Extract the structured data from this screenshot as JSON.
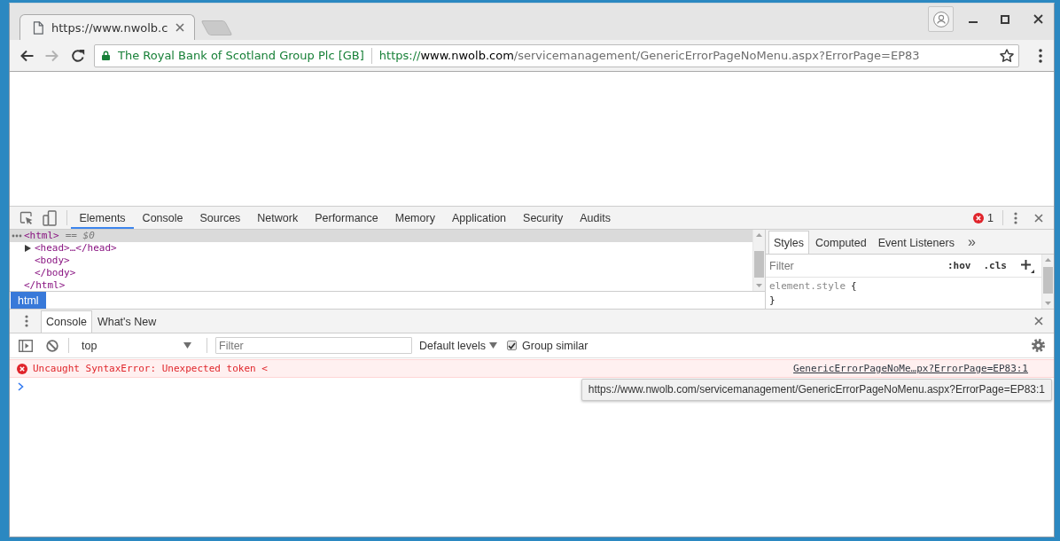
{
  "browser": {
    "tabs": [
      {
        "title": "https://www.nwolb.c",
        "selected": true
      }
    ],
    "nav_buttons": [
      {
        "kind": "back",
        "disabled": false
      },
      {
        "kind": "forward",
        "disabled": true
      },
      {
        "kind": "reload",
        "disabled": false
      }
    ],
    "address_bar": {
      "ev_name": "The Royal Bank of Scotland Group Plc [GB]",
      "url": [
        {
          "kind": "scheme",
          "text": "https://"
        },
        {
          "kind": "host",
          "text": "www.nwolb.com"
        },
        {
          "kind": "path",
          "text": "/servicemanagement/GenericErrorPageNoMenu.aspx?ErrorPage=EP83"
        }
      ]
    }
  },
  "devtools": {
    "tabs": [
      {
        "label": "Elements",
        "selected": true
      },
      {
        "label": "Console",
        "selected": false
      },
      {
        "label": "Sources",
        "selected": false
      },
      {
        "label": "Network",
        "selected": false
      },
      {
        "label": "Performance",
        "selected": false
      },
      {
        "label": "Memory",
        "selected": false
      },
      {
        "label": "Application",
        "selected": false
      },
      {
        "label": "Security",
        "selected": false
      },
      {
        "label": "Audits",
        "selected": false
      }
    ],
    "error_count": "1",
    "dom_tree": [
      {
        "tag": "<html>",
        "note": "== $0",
        "close": "</html>",
        "selected": true,
        "children": [
          {
            "tag": "<head>…</head>",
            "expanded": false,
            "selected": false
          },
          {
            "tag": "<body>",
            "close": "</body>",
            "selected": false
          }
        ]
      }
    ],
    "breadcrumbs": [
      {
        "label": "html",
        "selected": true
      }
    ],
    "styles_pane": {
      "tabs": [
        {
          "label": "Styles",
          "selected": true
        },
        {
          "label": "Computed",
          "selected": false
        },
        {
          "label": "Event Listeners",
          "selected": false
        }
      ],
      "more": "»",
      "filter": {
        "placeholder": "Filter"
      },
      "buttons": [
        ":hov",
        ".cls"
      ],
      "rules": [
        {
          "selector": "element.style",
          "open": "{",
          "close": "}"
        }
      ]
    },
    "drawer": {
      "tabs": [
        {
          "label": "Console",
          "selected": true
        },
        {
          "label": "What's New",
          "selected": false
        }
      ]
    },
    "console": {
      "context": "top",
      "filter": {
        "placeholder": "Filter"
      },
      "levels": "Default levels",
      "group_similar": {
        "label": "Group similar",
        "checked": true
      },
      "messages": [
        {
          "kind": "error",
          "text": "Uncaught SyntaxError: Unexpected token <",
          "source": "GenericErrorPageNoMe…px?ErrorPage=EP83:1"
        }
      ],
      "tooltip": "https://www.nwolb.com/servicemanagement/GenericErrorPageNoMenu.aspx?ErrorPage=EP83:1"
    }
  }
}
